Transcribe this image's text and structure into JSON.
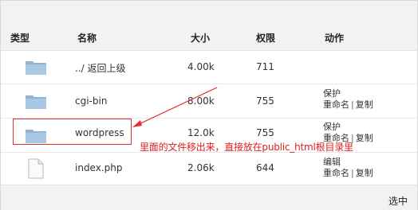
{
  "columns": {
    "type": "类型",
    "name": "名称",
    "size": "大小",
    "perm": "权限",
    "action": "动作"
  },
  "rows": [
    {
      "icon": "folder-icon",
      "name": "../ 返回上级",
      "size": "4.00k",
      "perm": "711",
      "actions": []
    },
    {
      "icon": "folder-icon",
      "name": "cgi-bin",
      "size": "8.00k",
      "perm": "755",
      "actions": [
        "保护",
        "重命名",
        "复制"
      ]
    },
    {
      "icon": "folder-icon",
      "name": "wordpress",
      "size": "12.0k",
      "perm": "755",
      "actions": [
        "保护",
        "重命名",
        "复制"
      ]
    },
    {
      "icon": "file-icon",
      "name": "index.php",
      "size": "2.06k",
      "perm": "644",
      "actions": [
        "编辑",
        "重命名",
        "复制"
      ]
    }
  ],
  "annotation": {
    "text": "里面的文件移出来，直接放在public_html根目录里",
    "color": "#e02020"
  },
  "footer": {
    "select_label": "选中"
  }
}
